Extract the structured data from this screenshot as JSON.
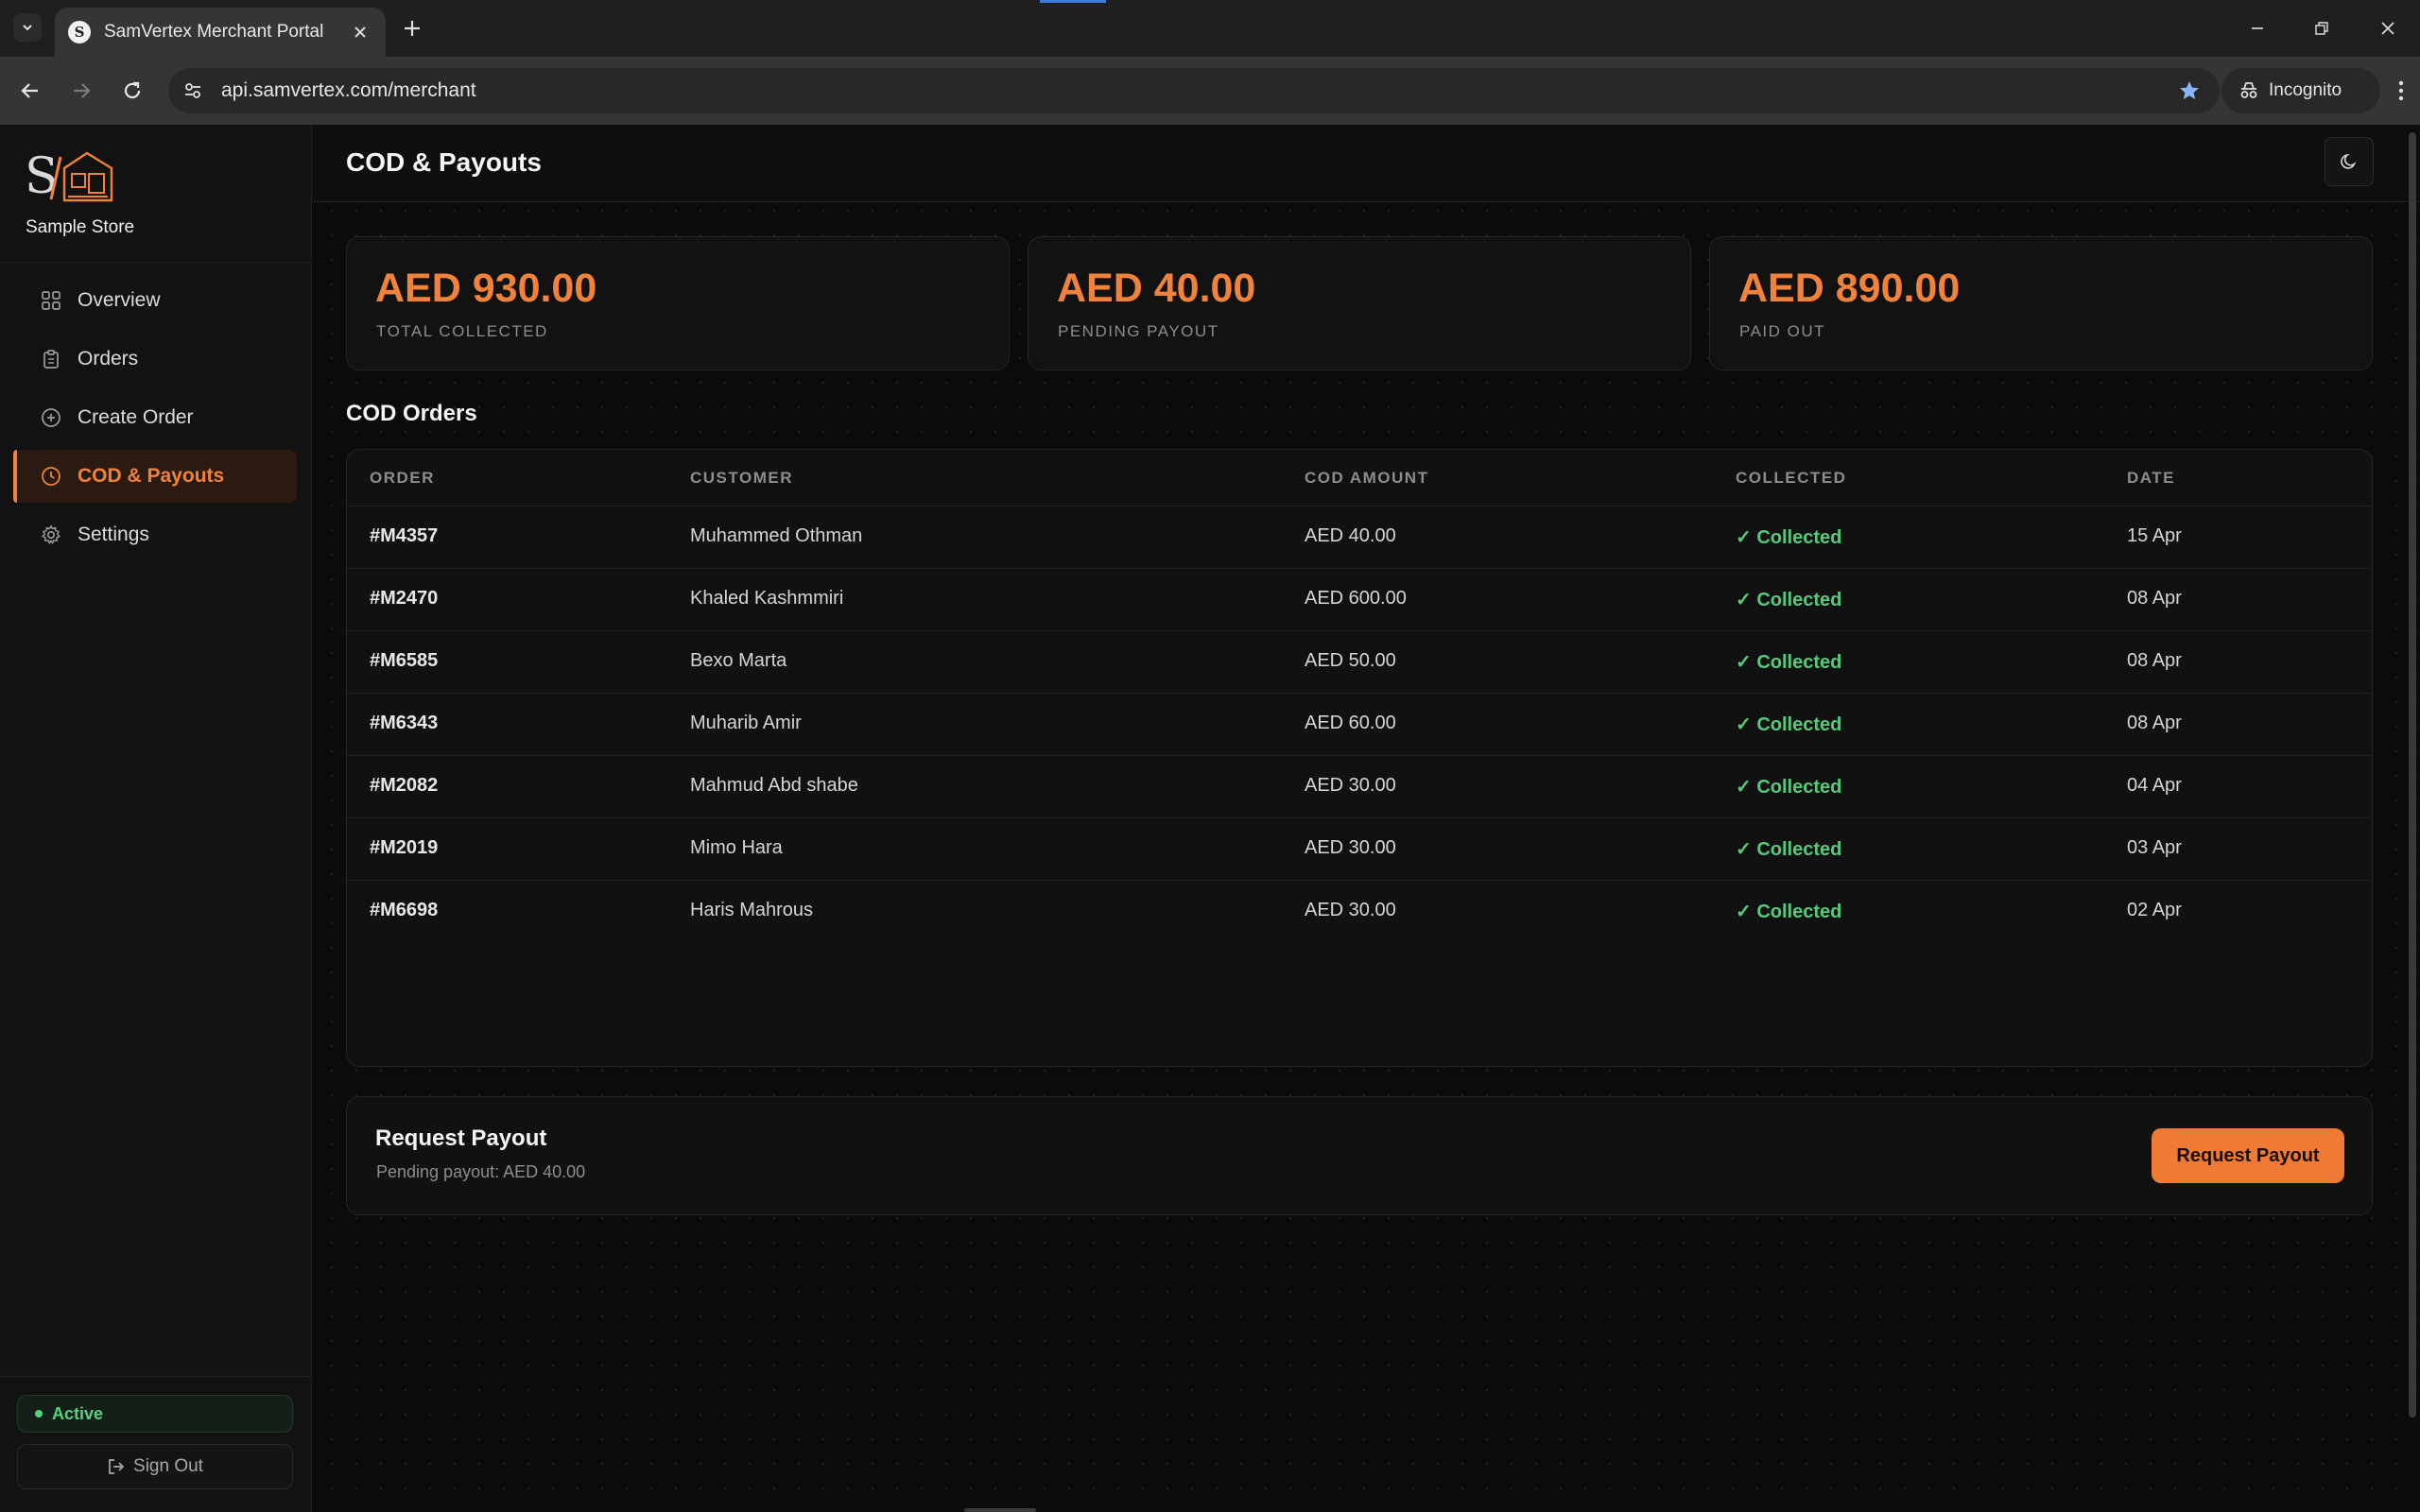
{
  "browser": {
    "tab_title": "SamVertex Merchant Portal",
    "favicon_letter": "S",
    "url": "api.samvertex.com/merchant",
    "incognito_label": "Incognito"
  },
  "sidebar": {
    "store_name": "Sample Store",
    "items": [
      {
        "label": "Overview",
        "icon": "grid-icon"
      },
      {
        "label": "Orders",
        "icon": "clipboard-icon"
      },
      {
        "label": "Create Order",
        "icon": "plus-circle-icon"
      },
      {
        "label": "COD & Payouts",
        "icon": "clock-icon",
        "active": true
      },
      {
        "label": "Settings",
        "icon": "gear-icon"
      }
    ],
    "status": "Active",
    "sign_out": "Sign Out"
  },
  "header": {
    "title": "COD & Payouts"
  },
  "stats": [
    {
      "value": "AED 930.00",
      "label": "TOTAL COLLECTED"
    },
    {
      "value": "AED 40.00",
      "label": "PENDING PAYOUT"
    },
    {
      "value": "AED 890.00",
      "label": "PAID OUT"
    }
  ],
  "orders_section": {
    "title": "COD Orders",
    "columns": [
      "ORDER",
      "CUSTOMER",
      "COD AMOUNT",
      "COLLECTED",
      "DATE"
    ],
    "rows": [
      {
        "order": "#M4357",
        "customer": "Muhammed Othman",
        "amount": "AED 40.00",
        "collected": "✓ Collected",
        "date": "15 Apr"
      },
      {
        "order": "#M2470",
        "customer": "Khaled Kashmmiri",
        "amount": "AED 600.00",
        "collected": "✓ Collected",
        "date": "08 Apr"
      },
      {
        "order": "#M6585",
        "customer": "Bexo Marta",
        "amount": "AED 50.00",
        "collected": "✓ Collected",
        "date": "08 Apr"
      },
      {
        "order": "#M6343",
        "customer": "Muharib Amir",
        "amount": "AED 60.00",
        "collected": "✓ Collected",
        "date": "08 Apr"
      },
      {
        "order": "#M2082",
        "customer": "Mahmud Abd shabe",
        "amount": "AED 30.00",
        "collected": "✓ Collected",
        "date": "04 Apr"
      },
      {
        "order": "#M2019",
        "customer": "Mimo Hara",
        "amount": "AED 30.00",
        "collected": "✓ Collected",
        "date": "03 Apr"
      },
      {
        "order": "#M6698",
        "customer": "Haris Mahrous",
        "amount": "AED 30.00",
        "collected": "✓ Collected",
        "date": "02 Apr"
      }
    ]
  },
  "payout": {
    "title": "Request Payout",
    "subtitle": "Pending payout: AED 40.00",
    "button_label": "Request Payout"
  },
  "colors": {
    "accent": "#f0823c",
    "success": "#57c97b",
    "background": "#0b0b0b"
  }
}
